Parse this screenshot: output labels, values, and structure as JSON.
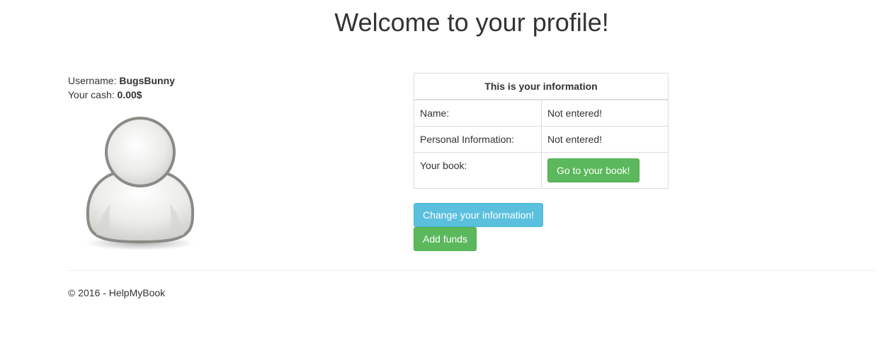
{
  "page": {
    "title": "Welcome to your profile!"
  },
  "user": {
    "username_label": "Username:",
    "username": "BugsBunny",
    "cash_label": "Your cash:",
    "cash": "0.00$",
    "avatar_icon": "user-silhouette-icon"
  },
  "info_table": {
    "header": "This is your information",
    "rows": [
      {
        "label": "Name:",
        "value": "Not entered!"
      },
      {
        "label": "Personal Information:",
        "value": "Not entered!"
      },
      {
        "label": "Your book:",
        "button": "Go to your book!"
      }
    ]
  },
  "actions": {
    "change_info": "Change your information!",
    "add_funds": "Add funds"
  },
  "footer": {
    "text": "© 2016 - HelpMyBook"
  },
  "colors": {
    "success": "#5cb85c",
    "info": "#5bc0de",
    "text": "#333333"
  }
}
